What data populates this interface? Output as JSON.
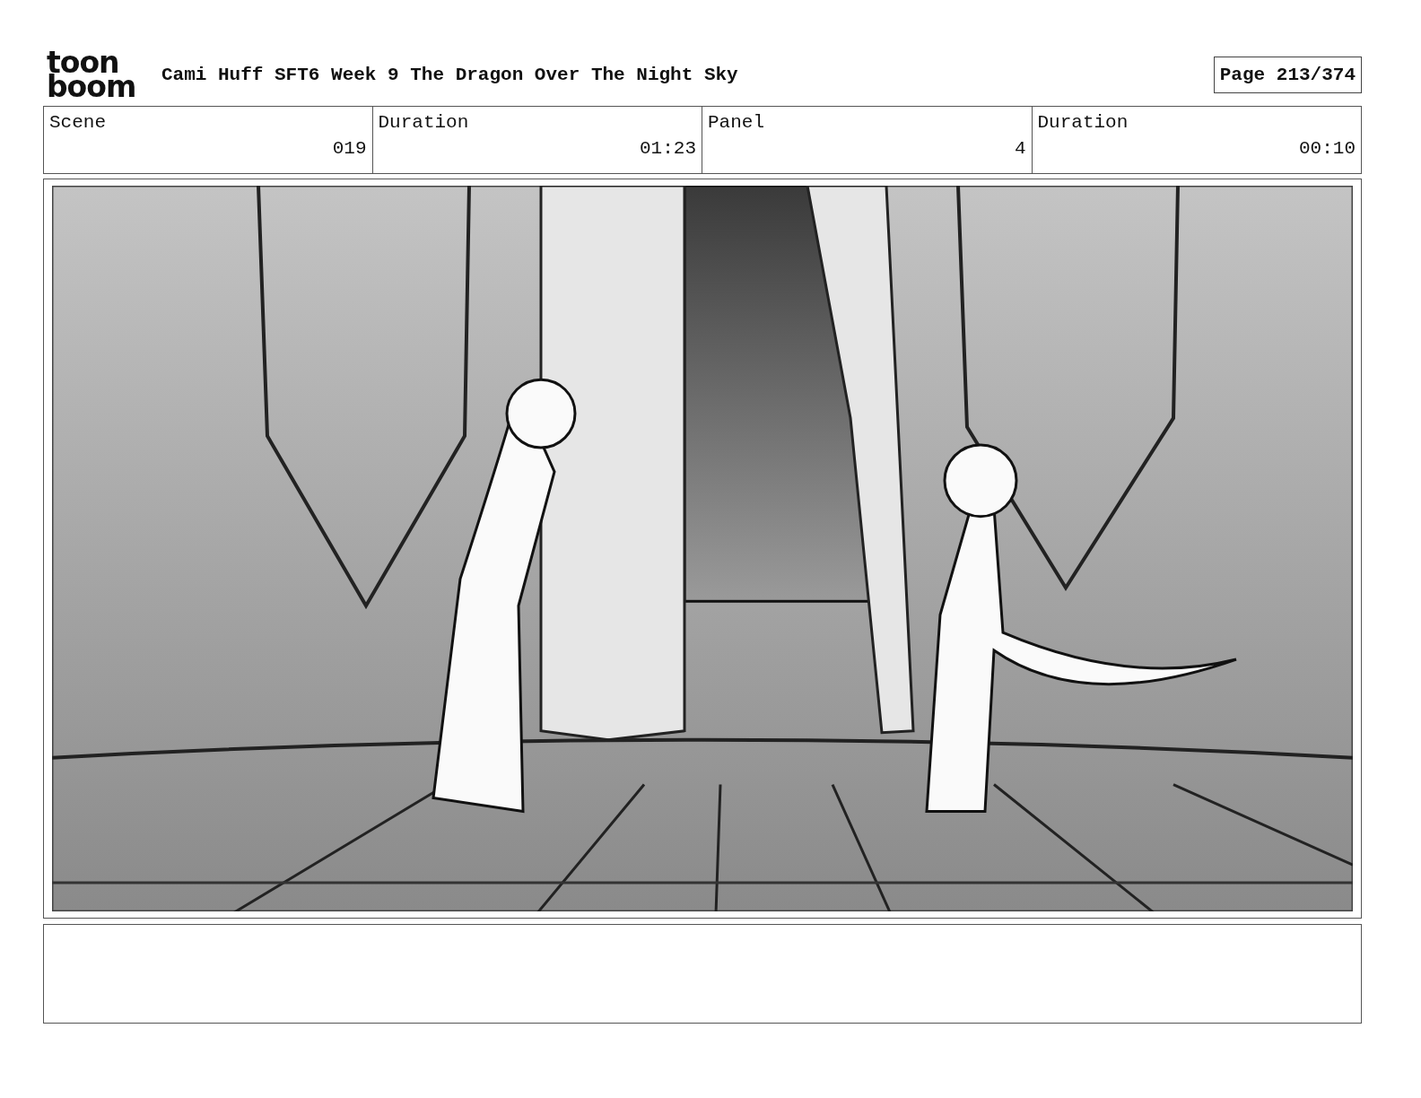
{
  "logo": {
    "line_1": "toon",
    "line_2": "boom"
  },
  "title": "Cami Huff SFT6 Week 9 The Dragon Over The Night Sky",
  "page": "Page 213/374",
  "info": {
    "headings": [
      "Scene",
      "Duration",
      "Panel",
      "Duration"
    ],
    "entries": [
      "019",
      "01:23",
      "4",
      "00:10"
    ]
  }
}
